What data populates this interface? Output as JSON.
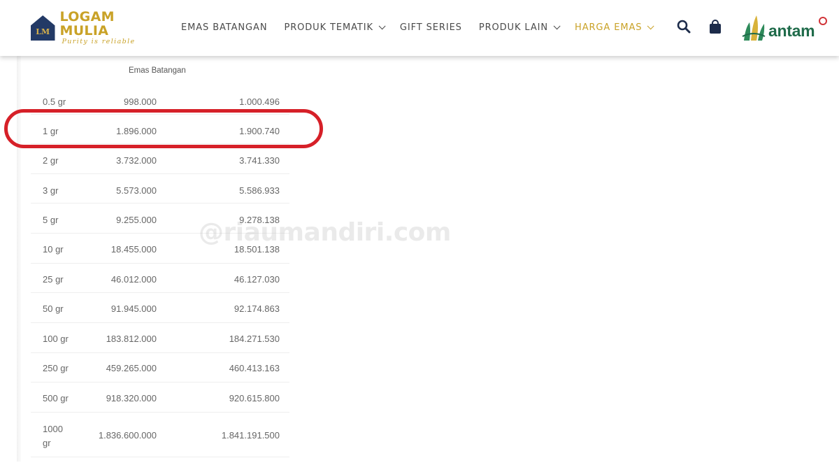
{
  "header": {
    "logo": {
      "title": "LOGAM MULIA",
      "tagline": "Purity is reliable",
      "mark": "LM"
    },
    "nav": [
      {
        "label": "EMAS BATANGAN",
        "dropdown": false,
        "active": false
      },
      {
        "label": "PRODUK TEMATIK",
        "dropdown": true,
        "active": false
      },
      {
        "label": "GIFT SERIES",
        "dropdown": false,
        "active": false
      },
      {
        "label": "PRODUK LAIN",
        "dropdown": true,
        "active": false
      },
      {
        "label": "HARGA EMAS",
        "dropdown": true,
        "active": true
      }
    ],
    "icons": {
      "search": "search-icon",
      "cart": "shopping-bag-icon"
    },
    "brand": {
      "text": "antam"
    },
    "colors": {
      "gold": "#c9a227",
      "navy": "#233a66",
      "antam_green": "#1f6b4a",
      "highlight_red": "#d62028"
    }
  },
  "table": {
    "heading": "Emas Batangan",
    "rows": [
      {
        "weight": "0.5 gr",
        "price": "998.000",
        "price_tax": "1.000.496"
      },
      {
        "weight": "1 gr",
        "price": "1.896.000",
        "price_tax": "1.900.740"
      },
      {
        "weight": "2 gr",
        "price": "3.732.000",
        "price_tax": "3.741.330"
      },
      {
        "weight": "3 gr",
        "price": "5.573.000",
        "price_tax": "5.586.933"
      },
      {
        "weight": "5 gr",
        "price": "9.255.000",
        "price_tax": "9.278.138"
      },
      {
        "weight": "10 gr",
        "price": "18.455.000",
        "price_tax": "18.501.138"
      },
      {
        "weight": "25 gr",
        "price": "46.012.000",
        "price_tax": "46.127.030"
      },
      {
        "weight": "50 gr",
        "price": "91.945.000",
        "price_tax": "92.174.863"
      },
      {
        "weight": "100 gr",
        "price": "183.812.000",
        "price_tax": "184.271.530"
      },
      {
        "weight": "250 gr",
        "price": "459.265.000",
        "price_tax": "460.413.163"
      },
      {
        "weight": "500 gr",
        "price": "918.320.000",
        "price_tax": "920.615.800"
      },
      {
        "weight_line1": "1000",
        "weight_line2": "gr",
        "price": "1.836.600.000",
        "price_tax": "1.841.191.500"
      }
    ],
    "highlighted_row": "1 gr"
  },
  "watermark": "@riaumandiri.com"
}
